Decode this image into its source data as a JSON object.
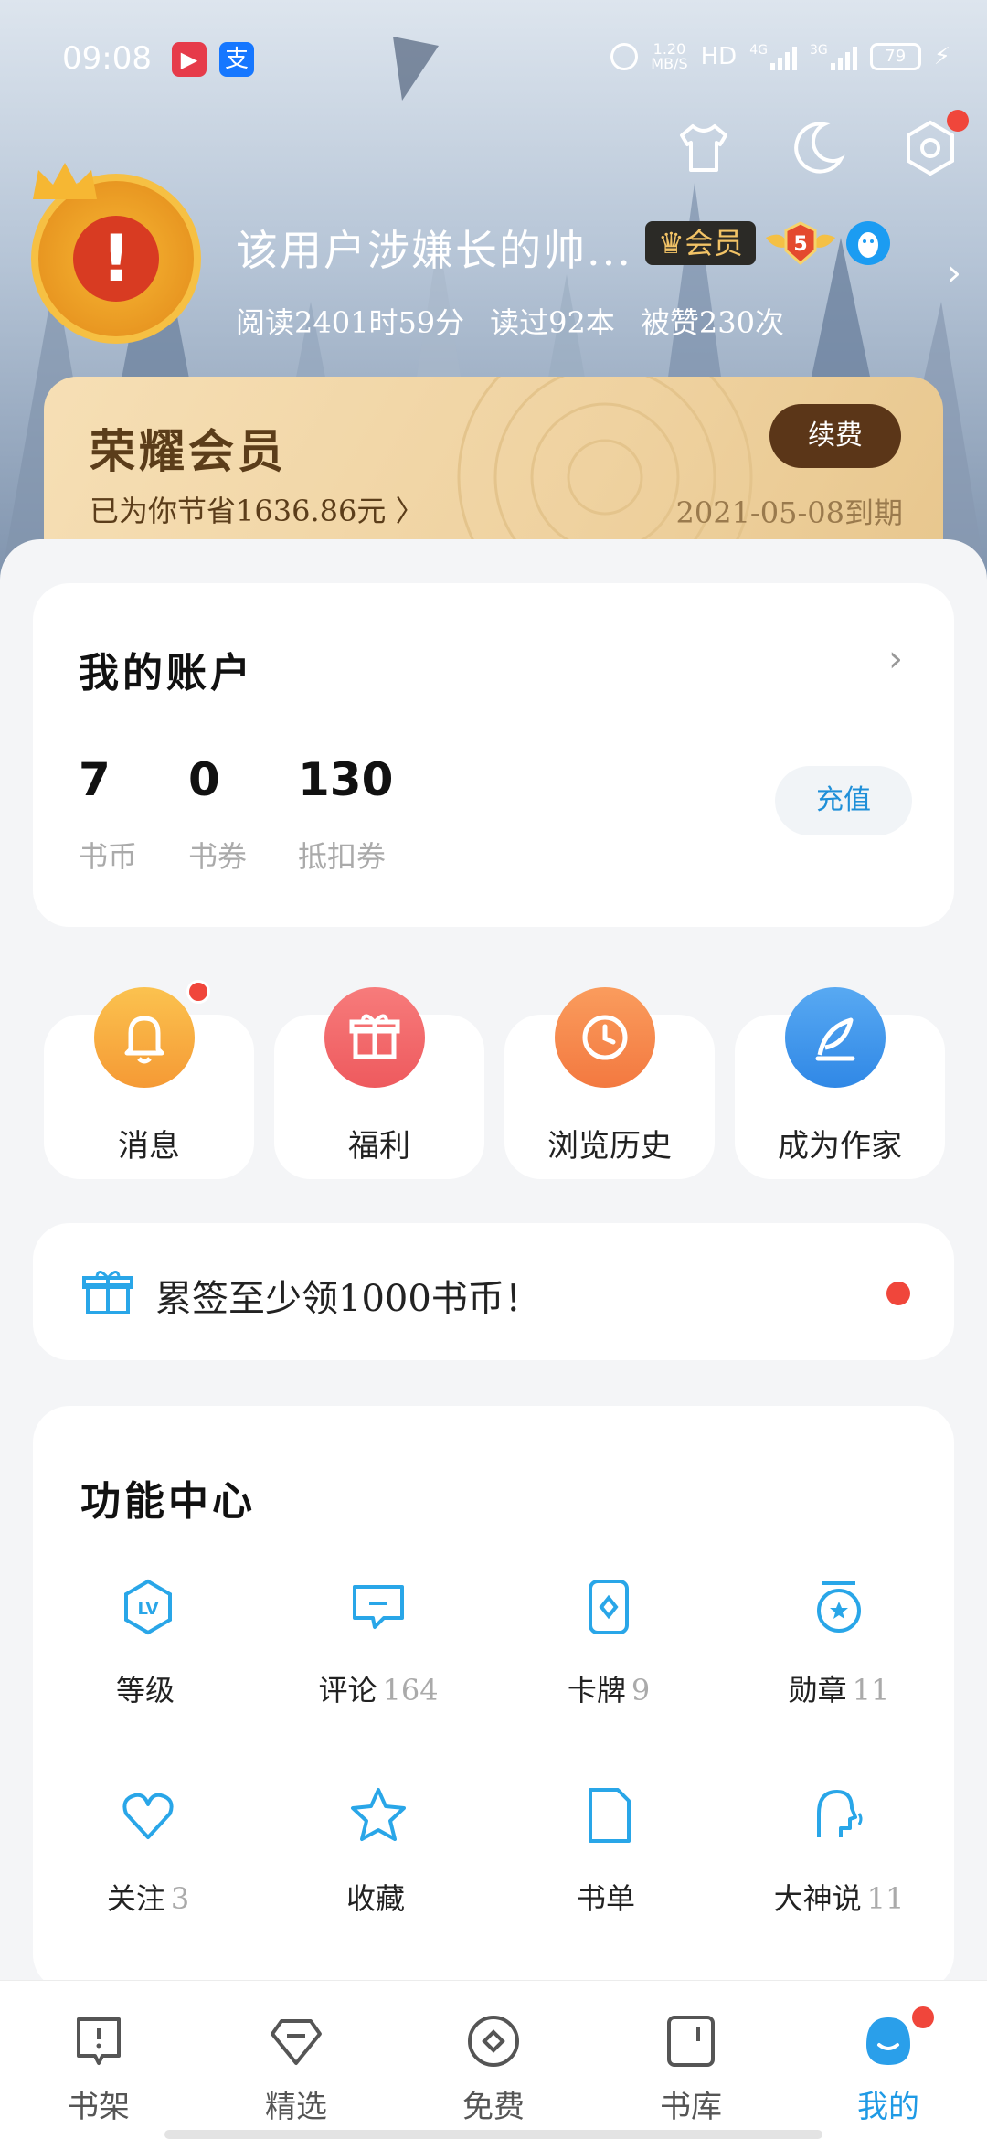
{
  "status_bar": {
    "time": "09:08",
    "app1_glyph": "▶",
    "app2_glyph": "支",
    "net_speed_top": "1.20",
    "net_speed_bottom": "MB/S",
    "hd_label": "HD",
    "sig1": "4G",
    "sig2": "3G",
    "battery": "79"
  },
  "profile": {
    "username": "该用户涉嫌长的帅...",
    "vip_badge": "♛会员",
    "level": "5",
    "stats": {
      "read_time": "阅读2401时59分",
      "books_read": "读过92本",
      "likes": "被赞230次"
    },
    "avatar_glyph": "!"
  },
  "membership": {
    "title": "荣耀会员",
    "saved": "已为你节省1636.86元 〉",
    "expire": "2021-05-08到期",
    "renew_label": "续费"
  },
  "account": {
    "title": "我的账户",
    "items": [
      {
        "value": "7",
        "label": "书币"
      },
      {
        "value": "0",
        "label": "书券"
      },
      {
        "value": "130",
        "label": "抵扣券"
      }
    ],
    "recharge_label": "充值"
  },
  "quick_actions": [
    {
      "label": "消息",
      "icon": "bell-icon",
      "color": "#f7ad3e"
    },
    {
      "label": "福利",
      "icon": "gift-icon",
      "color": "#f2686a"
    },
    {
      "label": "浏览历史",
      "icon": "clock-icon",
      "color": "#f58c50"
    },
    {
      "label": "成为作家",
      "icon": "feather-icon",
      "color": "#3d95ea"
    }
  ],
  "signin": {
    "text": "累签至少领1000书币！"
  },
  "function_center": {
    "title": "功能中心",
    "items": [
      {
        "label": "等级",
        "count": "",
        "icon": "level-icon"
      },
      {
        "label": "评论",
        "count": "164",
        "icon": "comment-icon"
      },
      {
        "label": "卡牌",
        "count": "9",
        "icon": "card-icon"
      },
      {
        "label": "勋章",
        "count": "11",
        "icon": "medal-icon"
      },
      {
        "label": "关注",
        "count": "3",
        "icon": "heart-icon"
      },
      {
        "label": "收藏",
        "count": "",
        "icon": "star-icon"
      },
      {
        "label": "书单",
        "count": "",
        "icon": "booklist-icon"
      },
      {
        "label": "大神说",
        "count": "11",
        "icon": "author-talk-icon"
      }
    ]
  },
  "bottom_nav": [
    {
      "label": "书架",
      "icon": "bookshelf-icon"
    },
    {
      "label": "精选",
      "icon": "featured-icon"
    },
    {
      "label": "免费",
      "icon": "free-icon"
    },
    {
      "label": "书库",
      "icon": "library-icon"
    },
    {
      "label": "我的",
      "icon": "profile-icon",
      "active": true
    }
  ],
  "colors": {
    "accent": "#1f9ae5",
    "badge_red": "#f0463b",
    "gold_text": "#5b3d1a"
  }
}
